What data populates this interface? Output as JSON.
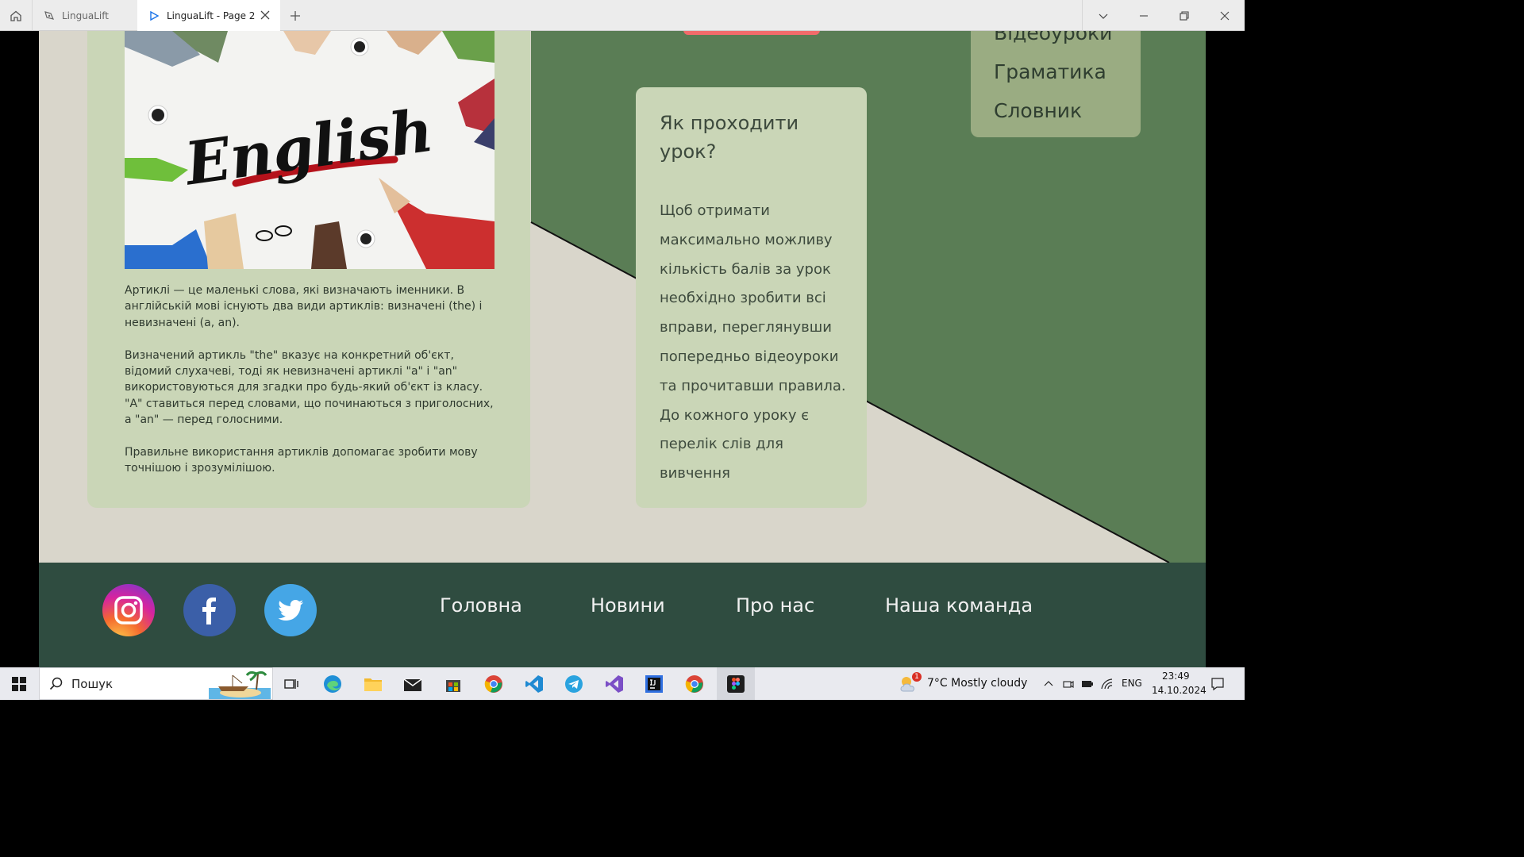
{
  "browser": {
    "tabs": [
      {
        "title": "LinguaLift"
      },
      {
        "title": "LinguaLift - Page 2"
      }
    ]
  },
  "article": {
    "paragraphs": [
      "Артиклі — це маленькі слова, які визначають іменники. В англійській мові існують два види артиклів: визначені (the) і невизначені (a, an).",
      "Визначений артикль \"the\" вказує на конкретний об'єкт, відомий слухачеві, тоді як невизначені артиклі \"a\" і \"an\" використовуються для згадки про будь-який об'єкт із класу. \"A\" ставиться перед словами, що починаються з приголосних, а \"an\" — перед голосними.",
      "Правильне використання артиклів допомагає зробити мову точнішою і зрозумілішою."
    ],
    "image_text": "English"
  },
  "lesson_card": {
    "title": "Як проходити урок?",
    "body": "Щоб отримати максимально можливу кількість балів за урок необхідно зробити всі вправи, переглянувши попередньо відеоуроки та прочитавши правила. До кожного уроку є перелік слів для вивчення"
  },
  "side_menu": {
    "items": [
      "Відеоуроки",
      "Граматика",
      "Словник"
    ]
  },
  "footer": {
    "nav": [
      "Головна",
      "Новини",
      "Про нас",
      "Наша команда"
    ],
    "social": [
      "instagram-icon",
      "facebook-icon",
      "twitter-icon"
    ]
  },
  "taskbar": {
    "search_placeholder": "Пошук",
    "weather": "7°C  Mostly cloudy",
    "weather_badge": "1",
    "language": "ENG",
    "time": "23:49",
    "date": "14.10.2024"
  },
  "colors": {
    "page_bg": "#d9d6cb",
    "green_band": "#5a7d55",
    "card": "#cad6b7",
    "menu_card": "#9aac82",
    "footer": "#2f4c40",
    "accent_pink": "#f26b6b"
  }
}
